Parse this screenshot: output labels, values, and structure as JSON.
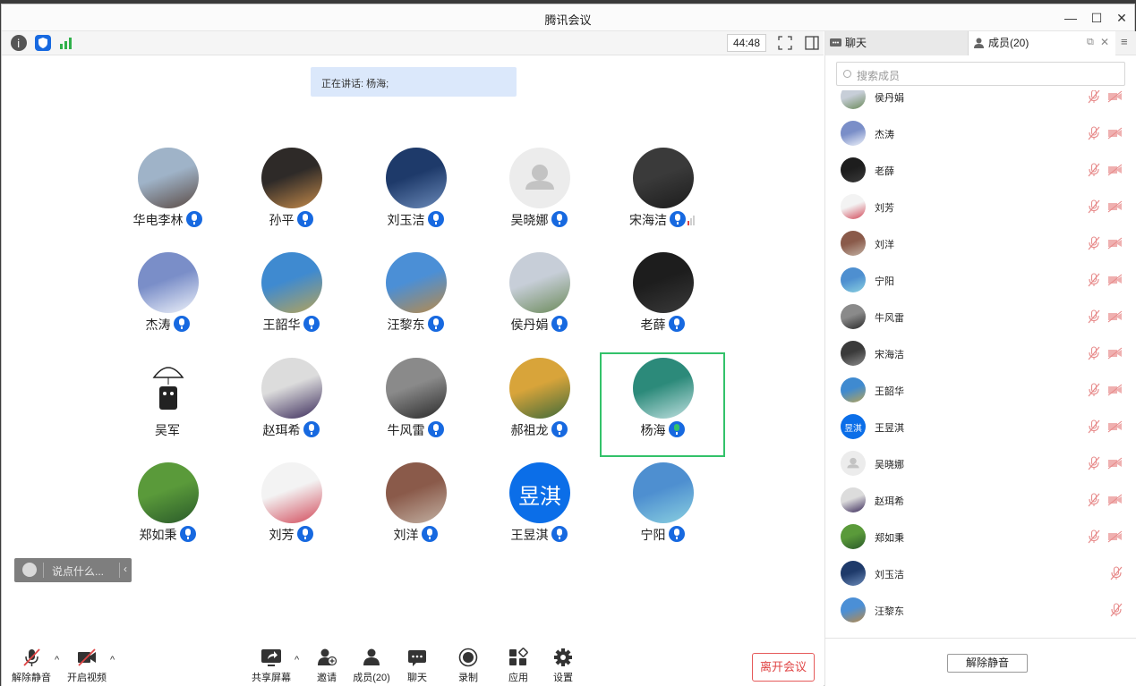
{
  "window": {
    "title": "腾讯会议",
    "minimize": "—",
    "maximize": "☐",
    "close": "✕"
  },
  "top_toolbar": {
    "timer": "44:48"
  },
  "speaking": {
    "text": "正在讲话: 杨海;"
  },
  "participants": [
    {
      "name": "华电李林",
      "colors": [
        "#9fb3c8",
        "#5a4a44"
      ],
      "mic": "blue"
    },
    {
      "name": "孙平",
      "colors": [
        "#2e2a28",
        "#c48a4a"
      ],
      "mic": "blue"
    },
    {
      "name": "刘玉洁",
      "colors": [
        "#1e3a6a",
        "#6a89b8"
      ],
      "mic": "blue"
    },
    {
      "name": "吴晓娜",
      "colors": [
        "#ececec",
        "#d2d2d2"
      ],
      "mic": "blue",
      "default": true
    },
    {
      "name": "宋海洁",
      "colors": [
        "#3a3a3a",
        "#1c1c1c"
      ],
      "mic": "blue",
      "signal": true
    },
    {
      "name": "杰涛",
      "colors": [
        "#7a8ec8",
        "#eef2fa"
      ],
      "mic": "blue"
    },
    {
      "name": "王韶华",
      "colors": [
        "#3f8ad0",
        "#b4a35a"
      ],
      "mic": "blue"
    },
    {
      "name": "汪黎东",
      "colors": [
        "#4b8fd6",
        "#b88a4a"
      ],
      "mic": "blue"
    },
    {
      "name": "侯丹娟",
      "colors": [
        "#c7ced8",
        "#6b8a5a"
      ],
      "mic": "blue"
    },
    {
      "name": "老薛",
      "colors": [
        "#1d1d1d",
        "#3a3a3a"
      ],
      "mic": "blue"
    },
    {
      "name": "吴军",
      "colors": [
        "#ffffff",
        "#ffffff"
      ],
      "mic": "none",
      "sketch": true
    },
    {
      "name": "赵珥希",
      "colors": [
        "#dcdcdc",
        "#3a2a5a"
      ],
      "mic": "blue"
    },
    {
      "name": "牛风雷",
      "colors": [
        "#8a8a8a",
        "#2a2a2a"
      ],
      "mic": "blue"
    },
    {
      "name": "郝祖龙",
      "colors": [
        "#d8a43a",
        "#3f6a3a"
      ],
      "mic": "blue"
    },
    {
      "name": "杨海",
      "colors": [
        "#2c8a7a",
        "#bfe0e0"
      ],
      "mic": "green",
      "active": true
    },
    {
      "name": "郑如秉",
      "colors": [
        "#5a9a3a",
        "#2a5a2a"
      ],
      "mic": "blue"
    },
    {
      "name": "刘芳",
      "colors": [
        "#f3f3f3",
        "#d24a5a"
      ],
      "mic": "blue"
    },
    {
      "name": "刘洋",
      "colors": [
        "#8a5a4a",
        "#c2b0a2"
      ],
      "mic": "blue"
    },
    {
      "name": "王昱淇",
      "colors": [
        "#0b6ee8",
        "#0b6ee8"
      ],
      "mic": "blue",
      "text_avatar": "昱淇"
    },
    {
      "name": "宁阳",
      "colors": [
        "#4e8fd0",
        "#8ad0e0"
      ],
      "mic": "blue"
    }
  ],
  "chat_input": {
    "placeholder": "说点什么..."
  },
  "bottom_bar": {
    "unmute": "解除静音",
    "start_video": "开启视频",
    "share_screen": "共享屏幕",
    "invite": "邀请",
    "members": "成员(20)",
    "chat": "聊天",
    "record": "录制",
    "apps": "应用",
    "settings": "设置",
    "leave": "离开会议"
  },
  "panel": {
    "tab_chat": "聊天",
    "tab_members": "成员(20)",
    "search_placeholder": "搜索成员",
    "unmute_all": "解除静音",
    "members": [
      {
        "name": "侯丹娟",
        "colors": [
          "#c7ced8",
          "#6b8a5a"
        ],
        "cam": true
      },
      {
        "name": "杰涛",
        "colors": [
          "#7a8ec8",
          "#eef2fa"
        ],
        "cam": true
      },
      {
        "name": "老薛",
        "colors": [
          "#1d1d1d",
          "#3a3a3a"
        ],
        "cam": true
      },
      {
        "name": "刘芳",
        "colors": [
          "#f3f3f3",
          "#d24a5a"
        ],
        "cam": true
      },
      {
        "name": "刘洋",
        "colors": [
          "#8a5a4a",
          "#c2b0a2"
        ],
        "cam": true
      },
      {
        "name": "宁阳",
        "colors": [
          "#4e8fd0",
          "#8ad0e0"
        ],
        "cam": true
      },
      {
        "name": "牛风雷",
        "colors": [
          "#8a8a8a",
          "#2a2a2a"
        ],
        "cam": true
      },
      {
        "name": "宋海洁",
        "colors": [
          "#3a3a3a",
          "#8a8a8a"
        ],
        "cam": true
      },
      {
        "name": "王韶华",
        "colors": [
          "#3f8ad0",
          "#b4a35a"
        ],
        "cam": true
      },
      {
        "name": "王昱淇",
        "colors": [
          "#0b6ee8",
          "#0b6ee8"
        ],
        "cam": true,
        "text_avatar": "昱淇"
      },
      {
        "name": "吴晓娜",
        "colors": [
          "#ececec",
          "#d2d2d2"
        ],
        "cam": true,
        "default": true
      },
      {
        "name": "赵珥希",
        "colors": [
          "#dcdcdc",
          "#3a2a5a"
        ],
        "cam": true
      },
      {
        "name": "郑如秉",
        "colors": [
          "#5a9a3a",
          "#2a5a2a"
        ],
        "cam": true
      },
      {
        "name": "刘玉洁",
        "colors": [
          "#1e3a6a",
          "#6a89b8"
        ],
        "cam": false
      },
      {
        "name": "汪黎东",
        "colors": [
          "#4b8fd6",
          "#b88a4a"
        ],
        "cam": false
      }
    ]
  },
  "colors": {
    "accent": "#1769e0",
    "active_border": "#33c26a",
    "leave_red": "#e04545",
    "mic_muted": "#e78a8a"
  }
}
